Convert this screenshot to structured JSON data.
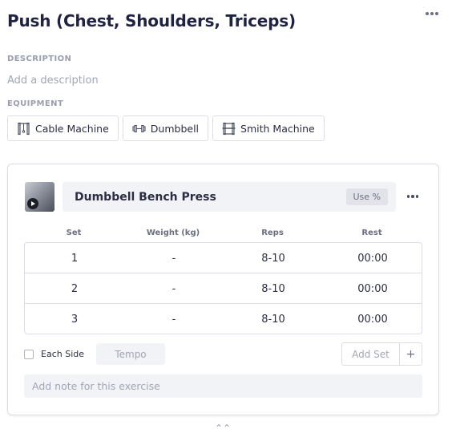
{
  "routine": {
    "title": "Push (Chest, Shoulders, Triceps)",
    "more_icon": "more-horizontal-icon"
  },
  "description": {
    "label": "DESCRIPTION",
    "placeholder": "Add a description",
    "value": ""
  },
  "equipment": {
    "label": "EQUIPMENT",
    "items": [
      {
        "label": "Cable Machine",
        "icon": "cable-machine-icon"
      },
      {
        "label": "Dumbbell",
        "icon": "dumbbell-icon"
      },
      {
        "label": "Smith Machine",
        "icon": "smith-machine-icon"
      }
    ]
  },
  "exercise": {
    "name": "Dumbbell Bench Press",
    "use_percent_label": "Use %",
    "thumbnail_icon": "play-icon",
    "columns": [
      "Set",
      "Weight (kg)",
      "Reps",
      "Rest"
    ],
    "sets": [
      {
        "set": "1",
        "weight": "-",
        "reps": "8-10",
        "rest": "00:00"
      },
      {
        "set": "2",
        "weight": "-",
        "reps": "8-10",
        "rest": "00:00"
      },
      {
        "set": "3",
        "weight": "-",
        "reps": "8-10",
        "rest": "00:00"
      }
    ],
    "each_side_label": "Each Side",
    "each_side_checked": false,
    "tempo_placeholder": "Tempo",
    "add_set_label": "Add Set",
    "add_set_plus": "+",
    "note_placeholder": "Add note for this exercise"
  },
  "colors": {
    "title": "#1f2240",
    "muted": "#a2a5b5",
    "border": "#dcdde5",
    "field_bg": "#f2f3f6"
  }
}
